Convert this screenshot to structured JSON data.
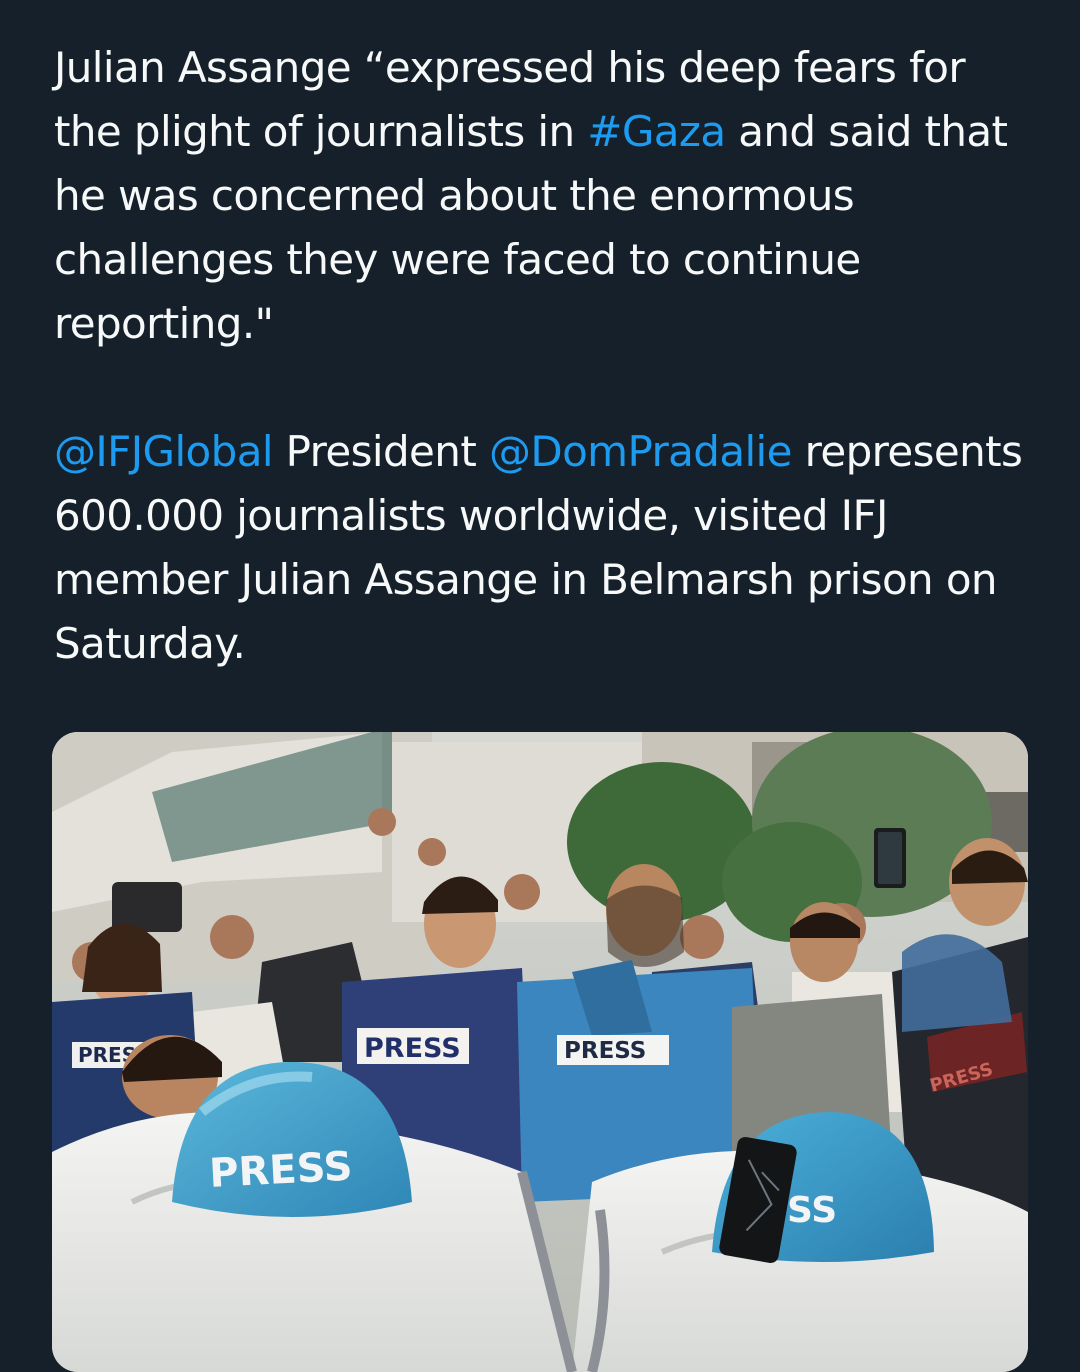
{
  "tweet": {
    "p1": {
      "t1": "Julian Assange “expressed his deep fears for the plight of journalists in ",
      "hashtag": "#Gaza",
      "t2": " and said that he was concerned about the enormous challenges they were faced to continue reporting.\""
    },
    "p2": {
      "mention1": "@IFJGlobal",
      "t1": " President ",
      "mention2": "@DomPradalie",
      "t2": " represents 600.000 journalists worldwide, visited IFJ member Julian Assange in Belmarsh prison on Saturday."
    }
  },
  "media": {
    "vest_center": "PRESS",
    "vest_left": "PRESS",
    "vest_far_left": "PRES",
    "vest_right": "PRESS",
    "helmet_left": "PRESS",
    "helmet_right": "SS"
  },
  "colors": {
    "background": "#15202b",
    "text": "#f7f9f9",
    "link": "#1d9bf0"
  }
}
